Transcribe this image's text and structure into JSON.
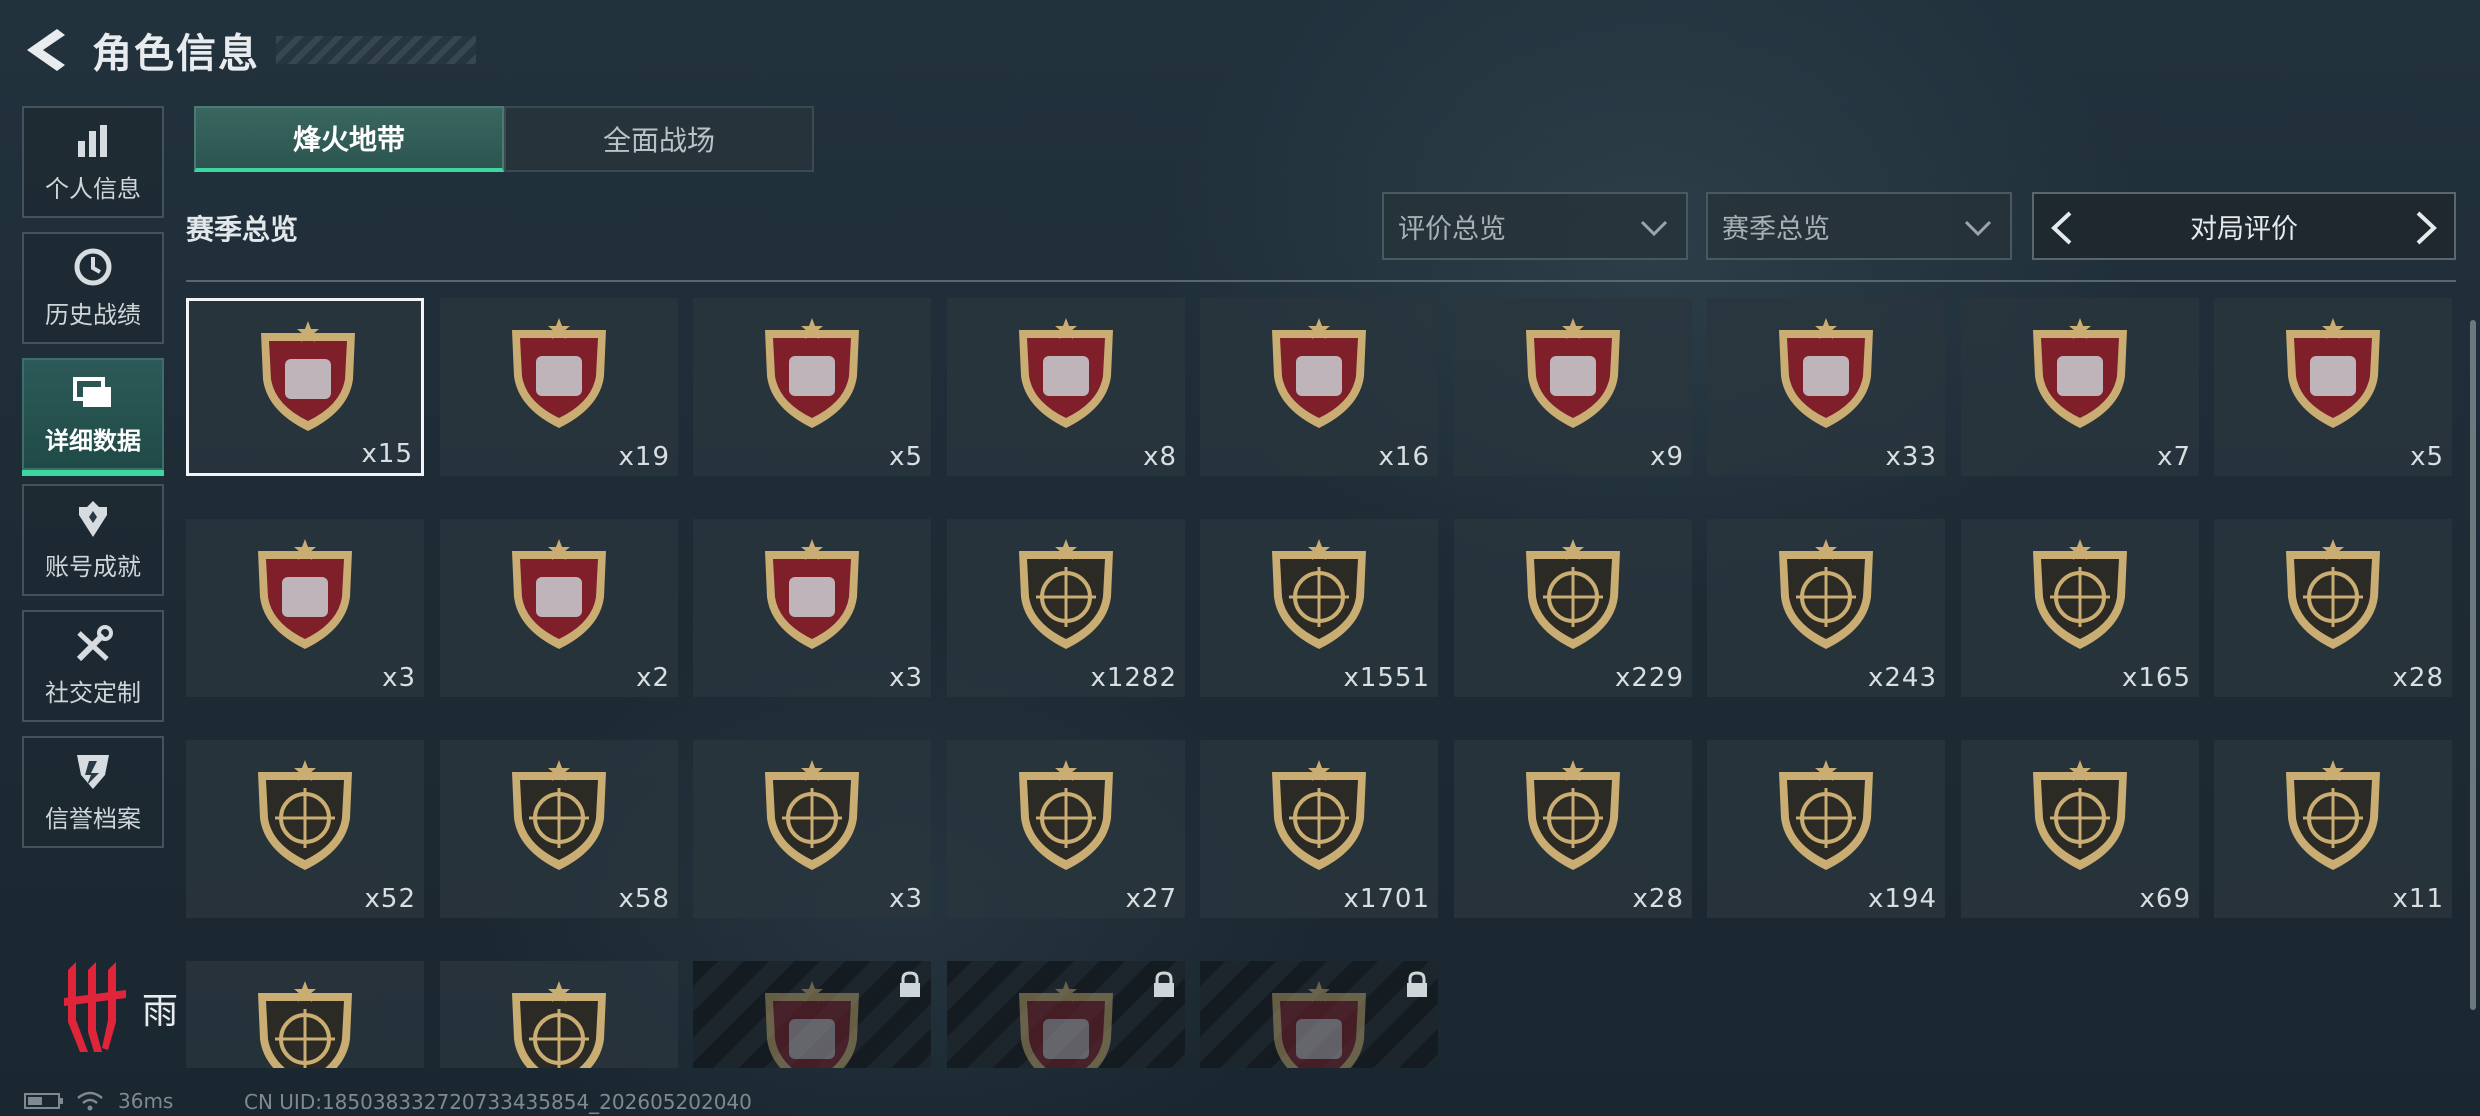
{
  "header": {
    "title": "角色信息"
  },
  "sidebar": {
    "items": [
      {
        "label": "个人信息",
        "icon": "bar-chart-icon",
        "active": false
      },
      {
        "label": "历史战绩",
        "icon": "history-clock-icon",
        "active": false
      },
      {
        "label": "详细数据",
        "icon": "folder-icon",
        "active": true
      },
      {
        "label": "账号成就",
        "icon": "achievement-icon",
        "active": false
      },
      {
        "label": "社交定制",
        "icon": "tools-icon",
        "active": false
      },
      {
        "label": "信誉档案",
        "icon": "credit-shield-icon",
        "active": false
      }
    ]
  },
  "tabs": [
    {
      "label": "烽火地带",
      "active": true
    },
    {
      "label": "全面战场",
      "active": false
    }
  ],
  "section": {
    "title": "赛季总览"
  },
  "filters": {
    "rating_overview": "评价总览",
    "season_overview": "赛季总览",
    "pager_label": "对局评价"
  },
  "badges": [
    {
      "count": "x15",
      "kind": "red",
      "icon": "diamond-icon",
      "selected": true
    },
    {
      "count": "x19",
      "kind": "red",
      "icon": "tank-icon"
    },
    {
      "count": "x5",
      "kind": "red",
      "icon": "computer-terminal-icon"
    },
    {
      "count": "x8",
      "kind": "red",
      "icon": "circuit-board-icon"
    },
    {
      "count": "x16",
      "kind": "red",
      "icon": "metal-plate-icon"
    },
    {
      "count": "x9",
      "kind": "red",
      "icon": "ammo-stack-icon"
    },
    {
      "count": "x33",
      "kind": "red",
      "icon": "mainboard-icon"
    },
    {
      "count": "x7",
      "kind": "red",
      "icon": "coffee-machine-icon"
    },
    {
      "count": "x5",
      "kind": "red",
      "icon": "reactor-core-icon"
    },
    {
      "count": "x3",
      "kind": "red",
      "icon": "jeweled-egg-icon"
    },
    {
      "count": "x2",
      "kind": "red",
      "icon": "chess-board-icon"
    },
    {
      "count": "x3",
      "kind": "red",
      "icon": "framed-painting-icon"
    },
    {
      "count": "x1282",
      "kind": "gold",
      "icon": "skull-burst-icon"
    },
    {
      "count": "x1551",
      "kind": "gold",
      "icon": "laurel-wings-icon"
    },
    {
      "count": "x229",
      "kind": "gold",
      "icon": "laurel-emblem-icon"
    },
    {
      "count": "x243",
      "kind": "gold",
      "icon": "rifle-crosshair-icon"
    },
    {
      "count": "x165",
      "kind": "gold",
      "icon": "smg-crosshair-icon"
    },
    {
      "count": "x28",
      "kind": "gold",
      "icon": "shotgun-crosshair-icon"
    },
    {
      "count": "x52",
      "kind": "gold",
      "icon": "lmg-crosshair-icon"
    },
    {
      "count": "x58",
      "kind": "gold",
      "icon": "marksman-crosshair-icon"
    },
    {
      "count": "x3",
      "kind": "gold",
      "icon": "sniper-crosshair-icon"
    },
    {
      "count": "x27",
      "kind": "gold",
      "icon": "pistol-crosshair-icon"
    },
    {
      "count": "x1701",
      "kind": "gold",
      "icon": "knife-crosshair-icon"
    },
    {
      "count": "x28",
      "kind": "gold",
      "icon": "beret-soldier-icon"
    },
    {
      "count": "x194",
      "kind": "gold",
      "icon": "hooded-operator-icon"
    },
    {
      "count": "x69",
      "kind": "gold",
      "icon": "masked-operator-icon"
    },
    {
      "count": "x11",
      "kind": "gold",
      "icon": "eyepatch-operator-icon"
    },
    {
      "count": "",
      "kind": "gold",
      "icon": "mask-face-icon"
    },
    {
      "count": "",
      "kind": "gold",
      "icon": "operator-portrait-icon"
    },
    {
      "count": "",
      "kind": "red",
      "icon": "orb-icon",
      "locked": true
    },
    {
      "count": "",
      "kind": "red",
      "icon": "machine-part-icon",
      "locked": true
    },
    {
      "count": "",
      "kind": "red",
      "icon": "canister-icon",
      "locked": true
    }
  ],
  "brand": {
    "glyph": "雨"
  },
  "status": {
    "ping": "36ms",
    "uid": "CN UID:185038332720733435854_202605202040"
  },
  "colors": {
    "accent": "#3ed6a0",
    "badge_red": "#7e1f2a",
    "badge_gold": "#c9ad72",
    "background": "#1c2a34"
  }
}
